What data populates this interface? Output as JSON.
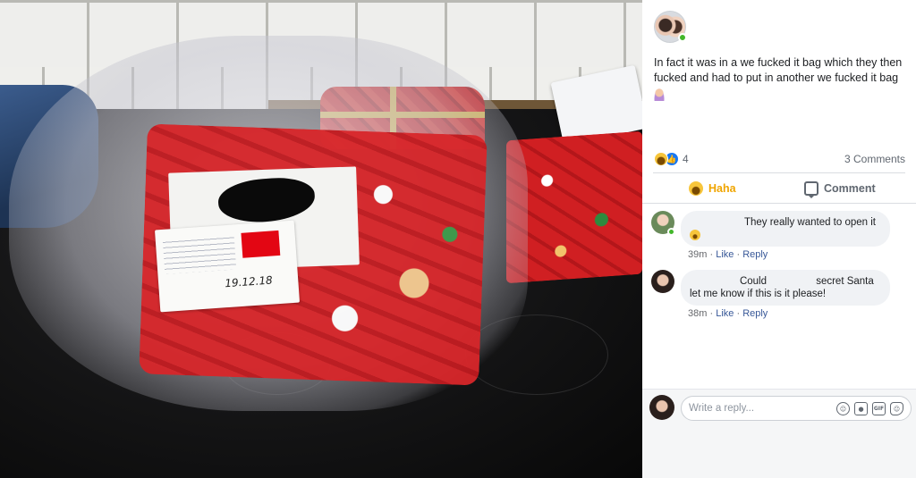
{
  "photo": {
    "label_date": "19.12.18"
  },
  "post": {
    "text": "In fact it was in a we fucked it bag which they then fucked and had to put in another we fucked it bag",
    "emoji": "woman-emoji"
  },
  "reactions": {
    "count": "4",
    "comments_count": "3 Comments",
    "icons": [
      "haha-icon",
      "like-icon"
    ]
  },
  "actions": {
    "haha_label": "Haha",
    "comment_label": "Comment"
  },
  "comments": [
    {
      "text": "They really wanted to open it",
      "time": "39m",
      "like_label": "Like",
      "reply_label": "Reply",
      "has_emoji": true
    },
    {
      "text_line1_a": "Could",
      "text_line1_b": "secret Santa",
      "text_line2": "let me know if this is it please!",
      "time": "38m",
      "like_label": "Like",
      "reply_label": "Reply"
    }
  ],
  "reply": {
    "placeholder": "Write a reply..."
  },
  "colors": {
    "facebook_blue": "#1877f2",
    "link_blue": "#385898",
    "haha_yellow": "#f0a500",
    "online_green": "#42b72a"
  }
}
